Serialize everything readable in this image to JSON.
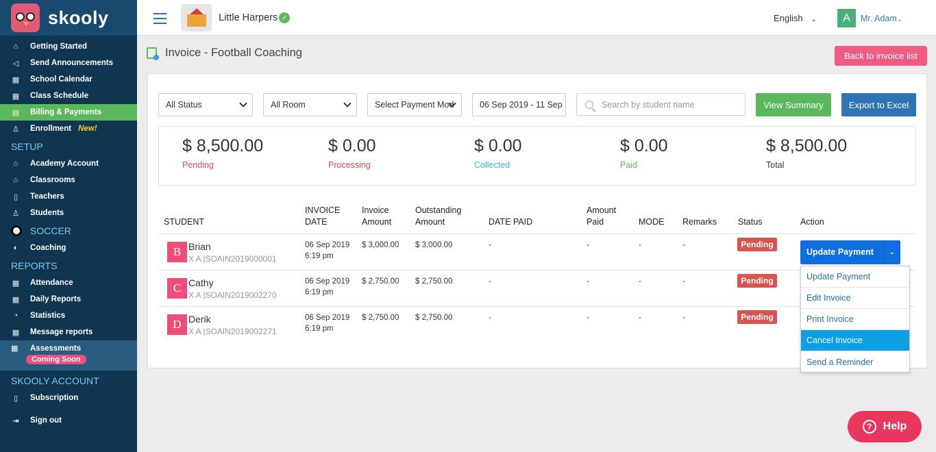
{
  "sidebar": {
    "logo_text": "skooly",
    "items_top": [
      {
        "label": "Getting Started",
        "icon": "home-icon"
      },
      {
        "label": "Send Announcements",
        "icon": "megaphone-icon"
      },
      {
        "label": "School Calendar",
        "icon": "calendar-icon"
      },
      {
        "label": "Class Schedule",
        "icon": "schedule-icon"
      },
      {
        "label": "Billing & Payments",
        "icon": "billing-icon"
      },
      {
        "label": "Enrollment",
        "icon": "enroll-icon",
        "badge": "New!"
      }
    ],
    "setup_title": "SETUP",
    "setup_items": [
      {
        "label": "Academy Account"
      },
      {
        "label": "Classrooms"
      },
      {
        "label": "Teachers"
      },
      {
        "label": "Students"
      }
    ],
    "soccer_title": "SOCCER",
    "soccer_items": [
      {
        "label": "Coaching"
      }
    ],
    "reports_title": "REPORTS",
    "reports_items": [
      {
        "label": "Attendance"
      },
      {
        "label": "Daily Reports"
      },
      {
        "label": "Statistics"
      },
      {
        "label": "Message reports"
      }
    ],
    "assessments": {
      "label": "Assessments",
      "badge": "Coming Soon"
    },
    "account_title": "SKOOLY ACCOUNT",
    "account_items": [
      {
        "label": "Subscription"
      },
      {
        "label": "Sign out"
      }
    ]
  },
  "topbar": {
    "school_name": "Little Harpers",
    "language": "English",
    "user_initial": "A",
    "user_name": "Mr. Adam"
  },
  "page": {
    "title": "Invoice - Football Coaching",
    "back_button": "Back to invoice list"
  },
  "filters": {
    "status": "All Status",
    "room": "All Room",
    "payment_mode": "Select Payment Mod",
    "date_range": "06 Sep 2019 - 11 Sep",
    "search_placeholder": "Search by student name",
    "view_summary": "View Summary",
    "export": "Export to Excel"
  },
  "summary": [
    {
      "amount": "$ 8,500.00",
      "label": "Pending",
      "color": "#d9534f"
    },
    {
      "amount": "$ 0.00",
      "label": "Processing",
      "color": "#d9534f"
    },
    {
      "amount": "$ 0.00",
      "label": "Collected",
      "color": "#3bb5d8"
    },
    {
      "amount": "$ 0.00",
      "label": "Paid",
      "color": "#5cb85c"
    },
    {
      "amount": "$ 8,500.00",
      "label": "Total",
      "color": "#333333"
    }
  ],
  "table": {
    "headers": {
      "student": "STUDENT",
      "invoice_date_1": "INVOICE",
      "invoice_date_2": "DATE",
      "invoice_amount_1": "Invoice",
      "invoice_amount_2": "Amount",
      "outstanding_1": "Outstanding",
      "outstanding_2": "Amount",
      "date_paid": "DATE PAID",
      "amount_paid_1": "Amount",
      "amount_paid_2": "Paid",
      "mode": "MODE",
      "remarks": "Remarks",
      "status": "Status",
      "action": "Action"
    },
    "rows": [
      {
        "initial": "B",
        "name": "Brian",
        "id": "X A |SOAIN2019000001",
        "date": "06 Sep 2019",
        "time": "6:19 pm",
        "invoice": "$ 3,000.00",
        "outstanding": "$ 3,000.00",
        "date_paid": "-",
        "amount_paid": "-",
        "mode": "-",
        "remarks": "-",
        "status": "Pending"
      },
      {
        "initial": "C",
        "name": "Cathy",
        "id": "X A |SOAIN2019002270",
        "date": "06 Sep 2019",
        "time": "6:19 pm",
        "invoice": "$ 2,750.00",
        "outstanding": "$ 2,750.00",
        "date_paid": "-",
        "amount_paid": "-",
        "mode": "-",
        "remarks": "-",
        "status": "Pending"
      },
      {
        "initial": "D",
        "name": "Derik",
        "id": "X A |SOAIN2019002271",
        "date": "06 Sep 2019",
        "time": "6:19 pm",
        "invoice": "$ 2,750.00",
        "outstanding": "$ 2,750.00",
        "date_paid": "-",
        "amount_paid": "-",
        "mode": "-",
        "remarks": "-",
        "status": "Pending"
      }
    ]
  },
  "action": {
    "button": "Update Payment",
    "menu": [
      "Update Payment",
      "Edit Invoice",
      "Print Invoice",
      "Cancel Invoice",
      "Send a Reminder"
    ]
  },
  "help": "Help"
}
